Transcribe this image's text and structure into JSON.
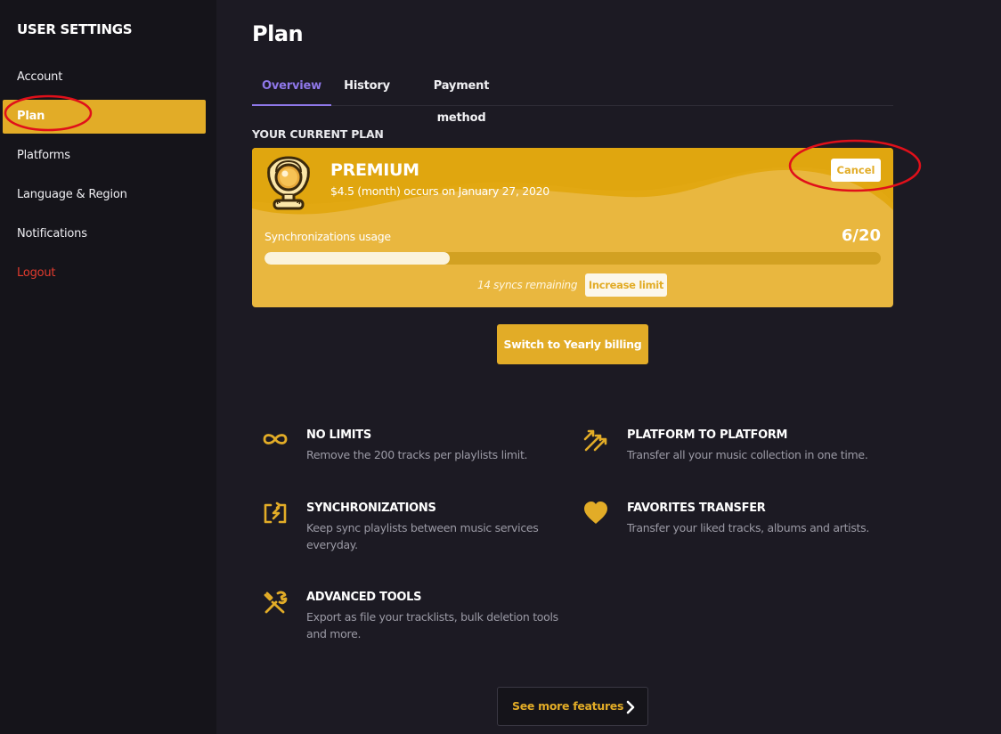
{
  "colors": {
    "accent": "#e2ac27",
    "tab_active": "#8e77e8",
    "logout": "#e23b2e",
    "annotation": "#e0101a"
  },
  "sidebar": {
    "title": "USER SETTINGS",
    "items": [
      {
        "label": "Account"
      },
      {
        "label": "Plan"
      },
      {
        "label": "Platforms"
      },
      {
        "label": "Language & Region"
      },
      {
        "label": "Notifications"
      },
      {
        "label": "Logout"
      }
    ],
    "active_index": 1
  },
  "main": {
    "title": "Plan",
    "tabs": [
      {
        "label": "Overview"
      },
      {
        "label": "History"
      },
      {
        "label": "Payment method"
      }
    ],
    "active_tab": 0,
    "section_label": "YOUR CURRENT PLAN",
    "plan": {
      "icon": "trophy-icon",
      "name": "PREMIUM",
      "billing": "$4.5 (month) occurs on January 27, 2020",
      "cancel_label": "Cancel",
      "usage_label": "Synchronizations usage",
      "usage_count": "6/20",
      "usage_fraction": 0.3,
      "remaining": "14 syncs remaining",
      "increase_label": "Increase limit"
    },
    "yearly_button": "Switch to Yearly billing",
    "features": [
      {
        "icon": "infinity-icon",
        "title": "NO LIMITS",
        "desc": "Remove the 200 tracks per playlists limit."
      },
      {
        "icon": "transfer-arrows-icon",
        "title": "PLATFORM TO PLATFORM",
        "desc": "Transfer all your music collection in one time."
      },
      {
        "icon": "sync-icon",
        "title": "SYNCHRONIZATIONS",
        "desc": "Keep sync playlists between music services everyday."
      },
      {
        "icon": "heart-icon",
        "title": "FAVORITES TRANSFER",
        "desc": "Transfer your liked tracks, albums and artists."
      },
      {
        "icon": "tools-icon",
        "title": "ADVANCED TOOLS",
        "desc": "Export as file your tracklists, bulk deletion tools and more."
      }
    ],
    "see_more": "See more features"
  }
}
